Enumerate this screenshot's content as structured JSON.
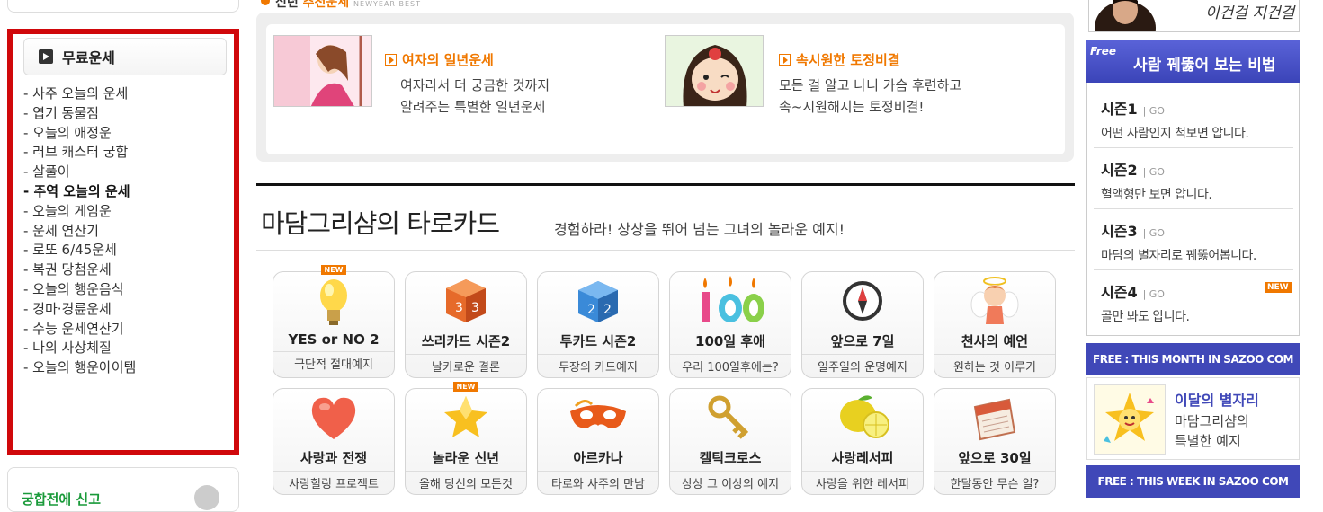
{
  "left": {
    "free_title": "무료운세",
    "menu": [
      {
        "label": "- 사주 오늘의 운세"
      },
      {
        "label": "- 엽기 동물점"
      },
      {
        "label": "- 오늘의 애정운"
      },
      {
        "label": "- 러브 캐스터 궁합"
      },
      {
        "label": "- 살풀이"
      },
      {
        "label": "- 주역 오늘의 운세",
        "active": true
      },
      {
        "label": "- 오늘의 게임운"
      },
      {
        "label": "- 운세 연산기"
      },
      {
        "label": "- 로또 6/45운세"
      },
      {
        "label": "- 복권 당첨운세"
      },
      {
        "label": "- 오늘의 행운음식"
      },
      {
        "label": "- 경마·경륜운세"
      },
      {
        "label": "- 수능 운세연산기"
      },
      {
        "label": "- 나의 사상체질"
      },
      {
        "label": "- 오늘의 행운아이템"
      }
    ],
    "bottom_label": "궁합전에 신고"
  },
  "newyear": {
    "title_prefix": "신년",
    "title_highlight": "추천운세",
    "title_sub": "NEWYEAR BEST",
    "items": [
      {
        "title": "여자의 일년운세",
        "desc1": "여자라서 더 궁금한 것까지",
        "desc2": "알려주는 특별한 일년운세"
      },
      {
        "title": "속시원한 토정비결",
        "desc1": "모든 걸 알고 나니 가슴 후련하고",
        "desc2": "속~시원해지는 토정비결!"
      }
    ]
  },
  "tarot": {
    "title": "마담그리샴의 타로카드",
    "subtitle": "경험하라! 상상을 뛰어 넘는 그녀의 놀라운 예지!",
    "new_label": "NEW",
    "cards": [
      {
        "title": "YES or NO 2",
        "desc": "극단적 절대예지",
        "icon": "lightbulb-icon"
      },
      {
        "title": "쓰리카드 시즌2",
        "desc": "날카로운 결론",
        "icon": "dice-three-icon"
      },
      {
        "title": "투카드 시즌2",
        "desc": "두장의 카드예지",
        "icon": "dice-two-icon"
      },
      {
        "title": "100일 후애",
        "desc": "우리 100일후에는?",
        "icon": "candles-100-icon"
      },
      {
        "title": "앞으로 7일",
        "desc": "일주일의 운명예지",
        "icon": "compass-icon"
      },
      {
        "title": "천사의 예언",
        "desc": "원하는 것 이루기",
        "icon": "angel-icon"
      },
      {
        "title": "사랑과 전쟁",
        "desc": "사랑힐링 프로젝트",
        "icon": "heart-icon"
      },
      {
        "title": "놀라운 신년",
        "desc": "올해 당신의 모든것",
        "icon": "star-icon"
      },
      {
        "title": "아르카나",
        "desc": "타로와 사주의 만남",
        "icon": "mask-icon"
      },
      {
        "title": "켈틱크로스",
        "desc": "상상 그 이상의 예지",
        "icon": "key-icon"
      },
      {
        "title": "사랑레서피",
        "desc": "사랑을 위한 레서피",
        "icon": "lemon-icon"
      },
      {
        "title": "앞으로 30일",
        "desc": "한달동안 무슨 일?",
        "icon": "calendar-icon"
      }
    ]
  },
  "right": {
    "top_text": "이건걸 지건걸",
    "secret_badge": "Free",
    "secret_title": "사람 꿰뚫어 보는 비법",
    "go_label": "GO",
    "new_label": "NEW",
    "seasons": [
      {
        "name": "시즌1",
        "desc": "어떤 사람인지 척보면 압니다."
      },
      {
        "name": "시즌2",
        "desc": "혈액형만 보면 압니다."
      },
      {
        "name": "시즌3",
        "desc": "마담의 별자리로 꿰뚫어봅니다."
      },
      {
        "name": "시즌4",
        "desc": "골만 봐도 압니다."
      }
    ],
    "month_bar": "FREE : THIS MONTH IN SAZOO COM",
    "star_title": "이달의 별자리",
    "star_desc1": "마담그리샴의",
    "star_desc2": "특별한 예지",
    "week_bar": "FREE : THIS WEEK IN SAZOO COM"
  },
  "colors": {
    "accent_orange": "#f07800",
    "red_border": "#d0080b",
    "blue": "#4048b8"
  }
}
